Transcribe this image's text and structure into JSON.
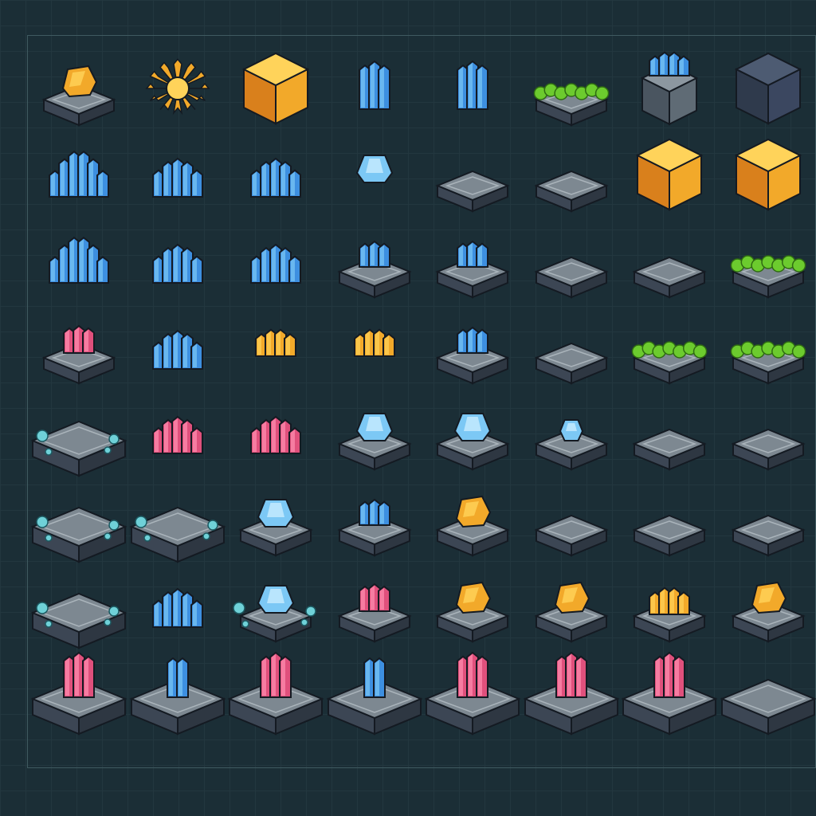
{
  "palette": {
    "background": "#1b2e36",
    "grid_line": "#3f5a60",
    "stone_top": "#7d8891",
    "stone_side": "#3c4654",
    "outline": "#141a22",
    "gold": "#f2a92a",
    "gold_light": "#ffd35a",
    "blue": "#3d8fe0",
    "blue_light": "#7cc8f5",
    "pink": "#e0507c",
    "pink_light": "#ff8fb0",
    "moss": "#6ccb2e",
    "bubble": "#6fd1d8"
  },
  "sprite_grid": {
    "columns": 8,
    "rows": 8,
    "tiles": [
      [
        "gold-ore-on-slab",
        "gold-crystal-burst",
        "gold-ore-block",
        "blue-crystal-shard",
        "blue-crystal-chunk",
        "moss-slab",
        "blue-crystals-on-stone-block",
        "dark-stone-block"
      ],
      [
        "blue-crystal-cluster-large",
        "blue-crystal-spikes",
        "blue-crystal-cluster",
        "blue-gem-tile",
        "stone-slab-small",
        "stone-slab-small",
        "gold-ore-block",
        "gold-ore-block"
      ],
      [
        "blue-crystal-cluster-large",
        "blue-crystal-pillars",
        "blue-crystal-cluster",
        "blue-crystal-slab",
        "blue-crystal-slab",
        "stone-slab",
        "stone-slab",
        "moss-slab"
      ],
      [
        "pink-crystal-slab",
        "blue-crystal-pillars",
        "gold-crystal-mound",
        "gold-crystal-mound",
        "blue-crystal-spire-slab",
        "stone-slab",
        "moss-slab",
        "moss-slab"
      ],
      [
        "stone-platform-with-bubbles",
        "pink-crystal-cluster",
        "pink-crystal-cluster",
        "blue-gem-slab",
        "blue-gem-slab",
        "blue-gem-slab-small",
        "stone-slab",
        "stone-slab-large"
      ],
      [
        "stone-platform-with-bubbles",
        "stone-platform-with-bubbles",
        "blue-gem-slab",
        "blue-crystal-slab",
        "gold-gem-slab",
        "stone-slab",
        "stone-slab",
        "stone-slab-offset"
      ],
      [
        "stone-platform-with-bubbles",
        "blue-crystal-pillars",
        "blue-gem-slab-bubbles",
        "pink-crystal-slab-small",
        "gold-gem-slab",
        "gold-gem-slab",
        "gold-crystal-slab",
        "gold-gem-slab-offset"
      ],
      [
        "pink-crystal-pedestal",
        "blue-crystal-pedestal",
        "pink-crystal-pedestal",
        "blue-crystal-pedestal",
        "pink-crystal-pedestal",
        "pink-crystal-pedestal",
        "pink-crystal-pedestal",
        "stone-pedestal"
      ]
    ]
  }
}
